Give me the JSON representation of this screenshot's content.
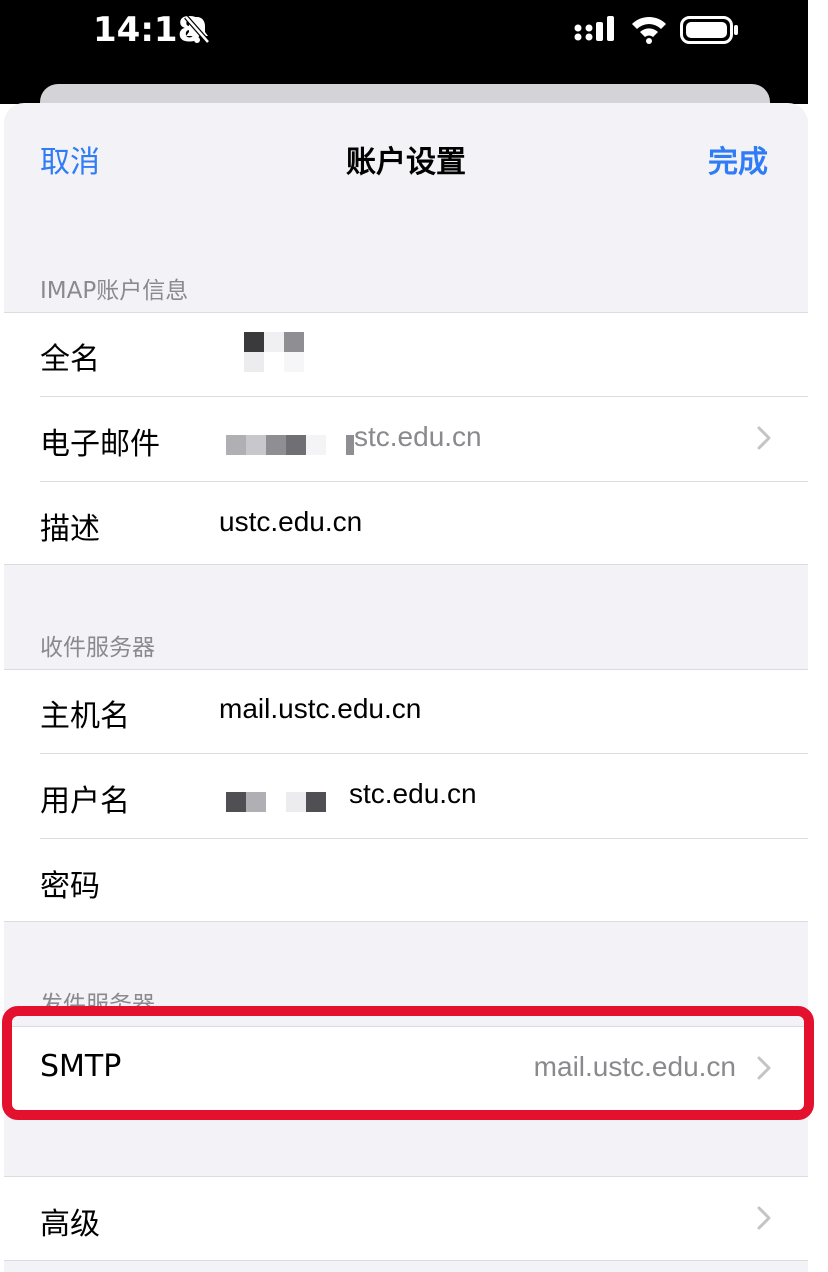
{
  "status_bar": {
    "time": "14:18",
    "icons": [
      "bell-slash-icon",
      "signal-icon",
      "wifi-icon",
      "battery-icon"
    ]
  },
  "nav": {
    "cancel": "取消",
    "title": "账户设置",
    "done": "完成"
  },
  "sections": {
    "imap": {
      "header": "IMAP账户信息",
      "full_name_label": "全名",
      "email_label": "电子邮件",
      "email_value": "stc.edu.cn",
      "description_label": "描述",
      "description_value": "ustc.edu.cn"
    },
    "incoming": {
      "header": "收件服务器",
      "host_label": "主机名",
      "host_value": "mail.ustc.edu.cn",
      "username_label": "用户名",
      "username_value": "stc.edu.cn",
      "password_label": "密码"
    },
    "outgoing": {
      "header": "发件服务器",
      "smtp_label": "SMTP",
      "smtp_value": "mail.ustc.edu.cn"
    },
    "advanced": {
      "label": "高级"
    }
  },
  "colors": {
    "accent": "#2f7cf6",
    "highlight": "#e4112e",
    "background": "#f2f2f7"
  }
}
